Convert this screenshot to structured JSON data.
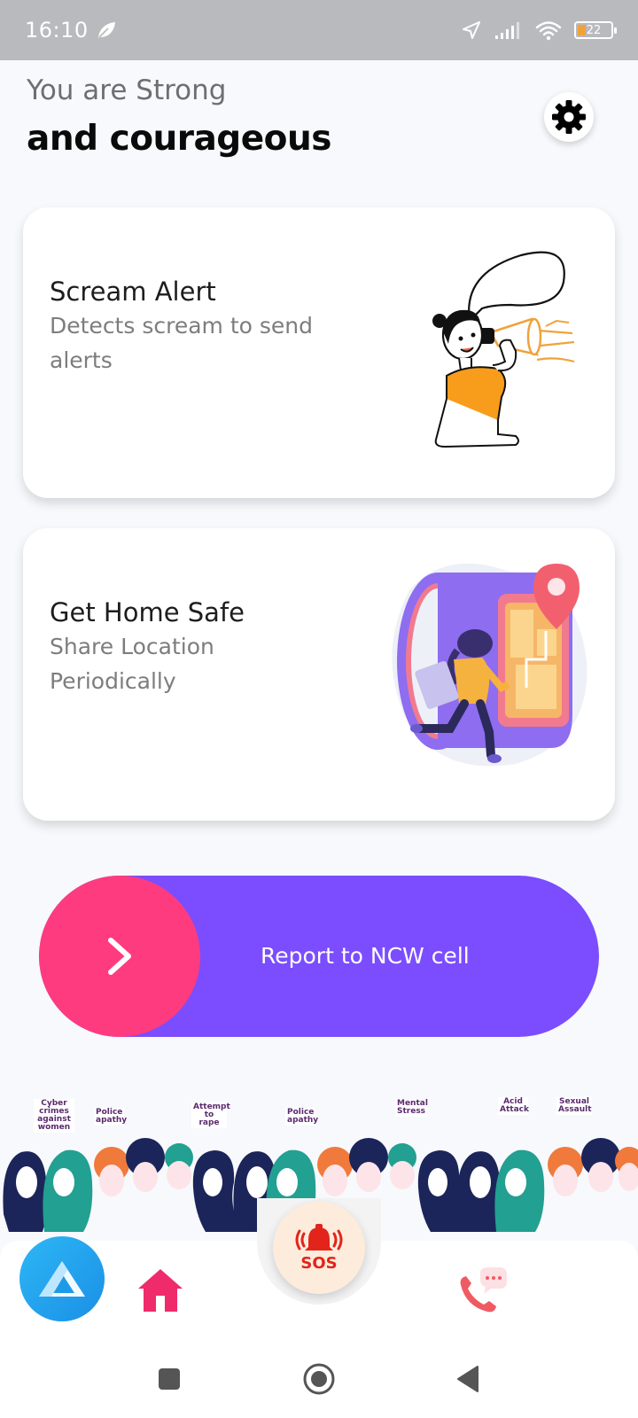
{
  "status_bar": {
    "time": "16:10",
    "battery": "22"
  },
  "greeting": {
    "line1": "You are Strong",
    "line2": "and courageous"
  },
  "cards": [
    {
      "title": "Scream Alert",
      "subtitle": "Detects scream to send alerts"
    },
    {
      "title": "Get Home Safe",
      "subtitle": "Share Location Periodically"
    }
  ],
  "report": {
    "label": "Report to NCW cell"
  },
  "banner_tags": [
    "Cyber crimes against women",
    "Police apathy",
    "Attempt to rape",
    "Police apathy",
    "Mental Stress",
    "Acid Attack",
    "Sexual Assault"
  ],
  "sos": {
    "label": "SOS"
  },
  "colors": {
    "primary_purple": "#7b4dff",
    "accent_pink": "#ff3b7f",
    "sos_red": "#e3241b",
    "app_blue": "#1a8fe6"
  },
  "icons": {
    "status": [
      "leaf-icon",
      "location-arrow-icon",
      "signal-icon",
      "wifi-icon",
      "battery-icon"
    ],
    "settings": "gear-icon",
    "report": "chevron-right-icon",
    "nav": [
      "app-logo-icon",
      "home-icon",
      "alarm-bell-icon",
      "phone-chat-icon"
    ],
    "system": [
      "square-icon",
      "circle-icon",
      "back-triangle-icon"
    ]
  }
}
